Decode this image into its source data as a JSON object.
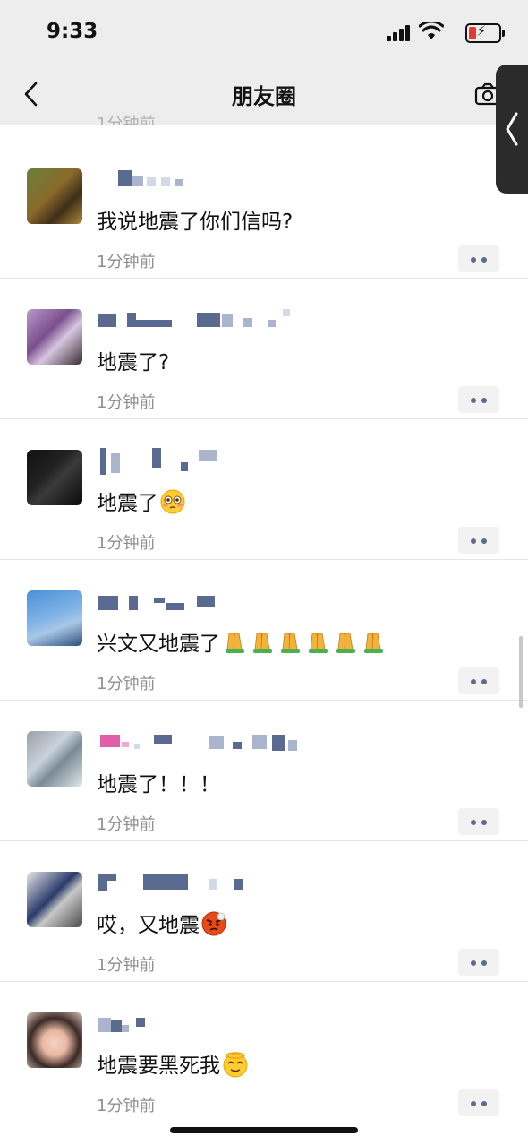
{
  "status_bar": {
    "time": "9:33"
  },
  "nav": {
    "title": "朋友圈"
  },
  "ghost_time": "1分钟前",
  "posts": [
    {
      "text": "我说地震了你们信吗?",
      "time": "1分钟前",
      "emoji_icon": ""
    },
    {
      "text": "地震了?",
      "time": "1分钟前",
      "emoji_icon": ""
    },
    {
      "text": "地震了",
      "time": "1分钟前",
      "emoji_icon": "flushed-face-icon"
    },
    {
      "text": "兴文又地震了",
      "time": "1分钟前",
      "emoji_icon": "folded-hands-icon"
    },
    {
      "text": "地震了！！！",
      "time": "1分钟前",
      "emoji_icon": ""
    },
    {
      "text": "哎，又地震",
      "time": "1分钟前",
      "emoji_icon": "angry-face-icon"
    },
    {
      "text": "地震要黑死我",
      "time": "1分钟前",
      "emoji_icon": "dizzy-face-icon"
    }
  ],
  "colors": {
    "nav_bg": "#ededed",
    "name_blue": "#5b6a91",
    "time_gray": "#8f8f8f",
    "battery_red": "#e53935"
  }
}
